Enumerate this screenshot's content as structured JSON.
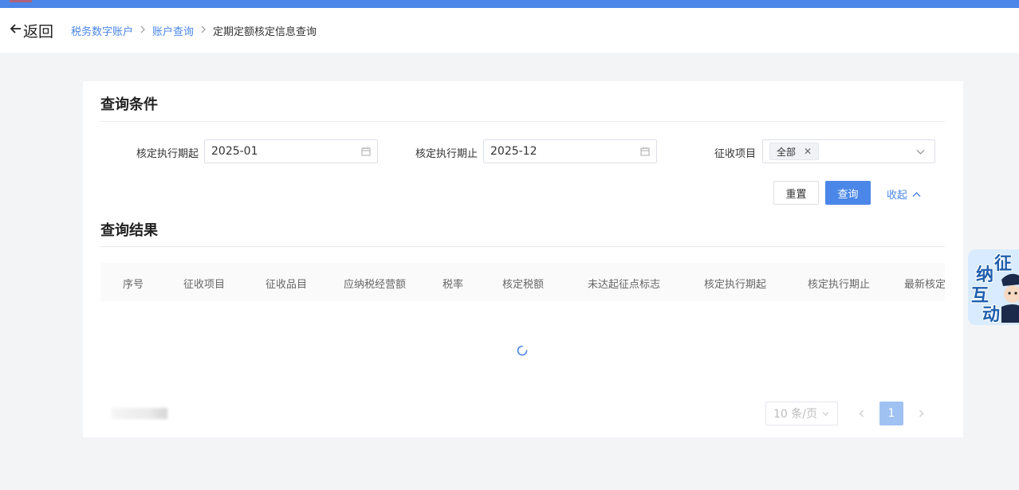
{
  "header": {
    "back_label": "返回",
    "breadcrumb": [
      "税务数字账户",
      "账户查询",
      "定期定额核定信息查询"
    ]
  },
  "query_section": {
    "title": "查询条件",
    "start_label": "核定执行期起",
    "start_value": "2025-01",
    "end_label": "核定执行期止",
    "end_value": "2025-12",
    "item_label": "征收项目",
    "item_tag": "全部",
    "reset_label": "重置",
    "query_label": "查询",
    "collapse_label": "收起"
  },
  "result_section": {
    "title": "查询结果",
    "columns": [
      "序号",
      "征收项目",
      "征收品目",
      "应纳税经营额",
      "税率",
      "核定税额",
      "未达起征点标志",
      "核定执行期起",
      "核定执行期止",
      "最新核定"
    ]
  },
  "pagination": {
    "page_size": "10 条/页",
    "current_page": "1"
  },
  "widget": {
    "chars": [
      "征",
      "纳",
      "互",
      "动"
    ]
  },
  "colors": {
    "accent": "#4a87e8",
    "page_active": "#a0c2f2",
    "background": "#f3f4f6"
  },
  "icons": [
    "back-arrow-icon",
    "chevron-right-icon",
    "calendar-icon",
    "close-icon",
    "chevron-down-icon",
    "chevron-up-icon",
    "loading-spinner-icon",
    "chevron-left-icon"
  ]
}
